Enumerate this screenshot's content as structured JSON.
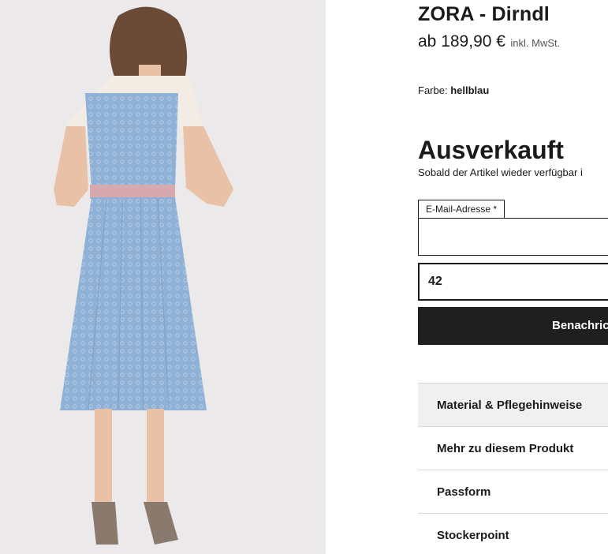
{
  "image": {
    "alt_icon": "product-photo"
  },
  "product": {
    "title": "ZORA - Dirndl",
    "price": "ab 189,90 €",
    "vat": "inkl. MwSt.",
    "color_label": "Farbe:",
    "color_value": "hellblau",
    "status": "Ausverkauft",
    "status_note": "Sobald der Artikel wieder verfügbar i"
  },
  "notify_form": {
    "email_label": "E-Mail-Adresse",
    "required_mark": "*",
    "email_value": "",
    "size_value": "42",
    "submit_label": "Benachric"
  },
  "accordion": [
    {
      "label": "Material & Pflegehinweise"
    },
    {
      "label": "Mehr zu diesem Produkt"
    },
    {
      "label": "Passform"
    },
    {
      "label": "Stockerpoint"
    }
  ],
  "colors": {
    "dress": "#8fb1d6",
    "button": "#1f1f1f",
    "background": "#ebe9ea"
  }
}
